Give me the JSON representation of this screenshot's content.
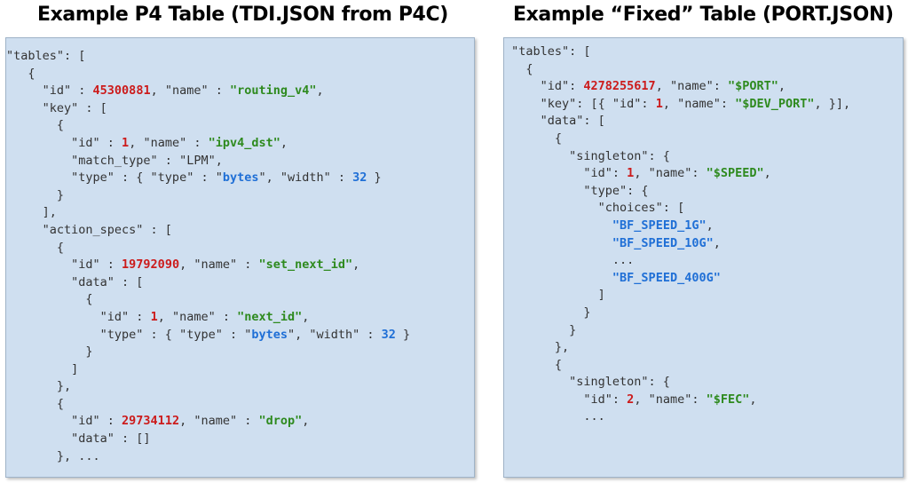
{
  "titles": {
    "left": "Example P4 Table (TDI.JSON from P4C)",
    "right": "Example “Fixed” Table (PORT.JSON)"
  },
  "colors": {
    "panel_bg": "#cfdff0",
    "number": "#cc1b1b",
    "string": "#2e8a1e",
    "keyword": "#1f6fd6",
    "plain": "#333333"
  },
  "left_code": [
    [
      {
        "t": "p",
        "v": "\"tables\": ["
      }
    ],
    [
      {
        "t": "p",
        "v": "   {"
      }
    ],
    [
      {
        "t": "p",
        "v": "     \"id\" : "
      },
      {
        "t": "num",
        "v": "45300881"
      },
      {
        "t": "p",
        "v": ", \"name\" : "
      },
      {
        "t": "str",
        "v": "\"routing_v4\""
      },
      {
        "t": "p",
        "v": ","
      }
    ],
    [
      {
        "t": "p",
        "v": "     \"key\" : ["
      }
    ],
    [
      {
        "t": "p",
        "v": "       {"
      }
    ],
    [
      {
        "t": "p",
        "v": "         \"id\" : "
      },
      {
        "t": "num",
        "v": "1"
      },
      {
        "t": "p",
        "v": ", \"name\" : "
      },
      {
        "t": "str",
        "v": "\"ipv4_dst\""
      },
      {
        "t": "p",
        "v": ","
      }
    ],
    [
      {
        "t": "p",
        "v": "         \"match_type\" : \"LPM\","
      }
    ],
    [
      {
        "t": "p",
        "v": "         \"type\" : { \"type\" : \""
      },
      {
        "t": "kw",
        "v": "bytes"
      },
      {
        "t": "p",
        "v": "\", \"width\" : "
      },
      {
        "t": "kw",
        "v": "32"
      },
      {
        "t": "p",
        "v": " }"
      }
    ],
    [
      {
        "t": "p",
        "v": "       }"
      }
    ],
    [
      {
        "t": "p",
        "v": "     ],"
      }
    ],
    [
      {
        "t": "p",
        "v": "     \"action_specs\" : ["
      }
    ],
    [
      {
        "t": "p",
        "v": "       {"
      }
    ],
    [
      {
        "t": "p",
        "v": "         \"id\" : "
      },
      {
        "t": "num",
        "v": "19792090"
      },
      {
        "t": "p",
        "v": ", \"name\" : "
      },
      {
        "t": "str",
        "v": "\"set_next_id\""
      },
      {
        "t": "p",
        "v": ","
      }
    ],
    [
      {
        "t": "p",
        "v": "         \"data\" : ["
      }
    ],
    [
      {
        "t": "p",
        "v": "           {"
      }
    ],
    [
      {
        "t": "p",
        "v": "             \"id\" : "
      },
      {
        "t": "num",
        "v": "1"
      },
      {
        "t": "p",
        "v": ", \"name\" : "
      },
      {
        "t": "str",
        "v": "\"next_id\""
      },
      {
        "t": "p",
        "v": ","
      }
    ],
    [
      {
        "t": "p",
        "v": "             \"type\" : { \"type\" : \""
      },
      {
        "t": "kw",
        "v": "bytes"
      },
      {
        "t": "p",
        "v": "\", \"width\" : "
      },
      {
        "t": "kw",
        "v": "32"
      },
      {
        "t": "p",
        "v": " }"
      }
    ],
    [
      {
        "t": "p",
        "v": "           }"
      }
    ],
    [
      {
        "t": "p",
        "v": "         ]"
      }
    ],
    [
      {
        "t": "p",
        "v": "       },"
      }
    ],
    [
      {
        "t": "p",
        "v": "       {"
      }
    ],
    [
      {
        "t": "p",
        "v": "         \"id\" : "
      },
      {
        "t": "num",
        "v": "29734112"
      },
      {
        "t": "p",
        "v": ", \"name\" : "
      },
      {
        "t": "str",
        "v": "\"drop\""
      },
      {
        "t": "p",
        "v": ","
      }
    ],
    [
      {
        "t": "p",
        "v": "         \"data\" : []"
      }
    ],
    [
      {
        "t": "p",
        "v": "       }, ..."
      }
    ]
  ],
  "right_code": [
    [
      {
        "t": "p",
        "v": " \"tables\": ["
      }
    ],
    [
      {
        "t": "p",
        "v": "   {"
      }
    ],
    [
      {
        "t": "p",
        "v": "     \"id\": "
      },
      {
        "t": "num",
        "v": "4278255617"
      },
      {
        "t": "p",
        "v": ", \"name\": "
      },
      {
        "t": "str",
        "v": "\"$PORT\""
      },
      {
        "t": "p",
        "v": ","
      }
    ],
    [
      {
        "t": "p",
        "v": "     \"key\": [{ \"id\": "
      },
      {
        "t": "num",
        "v": "1"
      },
      {
        "t": "p",
        "v": ", \"name\": "
      },
      {
        "t": "str",
        "v": "\"$DEV_PORT\""
      },
      {
        "t": "p",
        "v": ", }],"
      }
    ],
    [
      {
        "t": "p",
        "v": "     \"data\": ["
      }
    ],
    [
      {
        "t": "p",
        "v": "       {"
      }
    ],
    [
      {
        "t": "p",
        "v": "         \"singleton\": {"
      }
    ],
    [
      {
        "t": "p",
        "v": "           \"id\": "
      },
      {
        "t": "num",
        "v": "1"
      },
      {
        "t": "p",
        "v": ", \"name\": "
      },
      {
        "t": "str",
        "v": "\"$SPEED\""
      },
      {
        "t": "p",
        "v": ","
      }
    ],
    [
      {
        "t": "p",
        "v": "           \"type\": {"
      }
    ],
    [
      {
        "t": "p",
        "v": "             \"choices\": ["
      }
    ],
    [
      {
        "t": "p",
        "v": "               "
      },
      {
        "t": "kw",
        "v": "\"BF_SPEED_1G\""
      },
      {
        "t": "p",
        "v": ","
      }
    ],
    [
      {
        "t": "p",
        "v": "               "
      },
      {
        "t": "kw",
        "v": "\"BF_SPEED_10G\""
      },
      {
        "t": "p",
        "v": ","
      }
    ],
    [
      {
        "t": "p",
        "v": "               ..."
      }
    ],
    [
      {
        "t": "p",
        "v": "               "
      },
      {
        "t": "kw",
        "v": "\"BF_SPEED_400G\""
      }
    ],
    [
      {
        "t": "p",
        "v": "             ]"
      }
    ],
    [
      {
        "t": "p",
        "v": "           }"
      }
    ],
    [
      {
        "t": "p",
        "v": "         }"
      }
    ],
    [
      {
        "t": "p",
        "v": "       },"
      }
    ],
    [
      {
        "t": "p",
        "v": "       {"
      }
    ],
    [
      {
        "t": "p",
        "v": "         \"singleton\": {"
      }
    ],
    [
      {
        "t": "p",
        "v": "           \"id\": "
      },
      {
        "t": "num",
        "v": "2"
      },
      {
        "t": "p",
        "v": ", \"name\": "
      },
      {
        "t": "str",
        "v": "\"$FEC\""
      },
      {
        "t": "p",
        "v": ","
      }
    ],
    [
      {
        "t": "p",
        "v": "           ..."
      }
    ]
  ]
}
